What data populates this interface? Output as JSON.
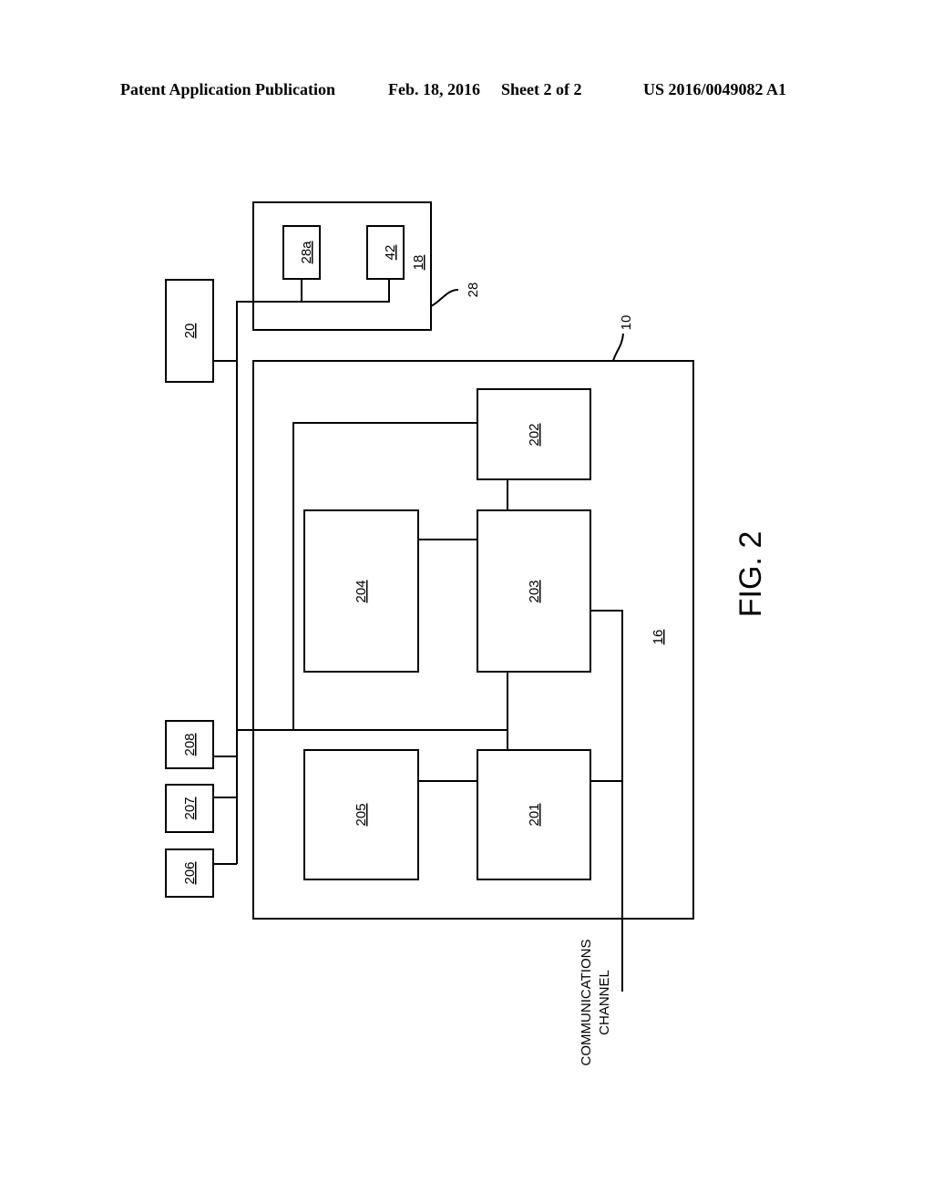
{
  "header": {
    "publication": "Patent Application Publication",
    "date": "Feb. 18, 2016",
    "sheet": "Sheet 2 of 2",
    "number": "US 2016/0049082 A1"
  },
  "figure": {
    "caption": "FIG. 2",
    "blocks": {
      "b10_ref": "10",
      "b16": "16",
      "b18": "18",
      "b20": "20",
      "b28_ref": "28",
      "b28a": "28a",
      "b42": "42",
      "b201": "201",
      "b202": "202",
      "b203": "203",
      "b204": "204",
      "b205": "205",
      "b206": "206",
      "b207": "207",
      "b208": "208"
    },
    "comm_label_line1": "COMMUNICATIONS",
    "comm_label_line2": "CHANNEL"
  }
}
